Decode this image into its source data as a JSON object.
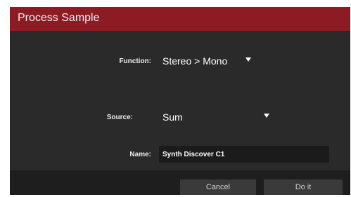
{
  "dialog": {
    "title": "Process Sample",
    "function": {
      "label": "Function:",
      "value": "Stereo > Mono"
    },
    "source": {
      "label": "Source:",
      "value": "Sum"
    },
    "name": {
      "label": "Name:",
      "value": "Synth Discover C1"
    },
    "buttons": {
      "cancel": "Cancel",
      "ok": "Do it"
    }
  },
  "colors": {
    "title_bar": "#8c1b24",
    "body_background": "#2a2a2a",
    "footer_background": "#1e1e1e",
    "field_background": "#1b1b1b",
    "button_background": "#3a3a3a"
  },
  "icons": {
    "dropdown_arrow": "caret-down-icon"
  }
}
